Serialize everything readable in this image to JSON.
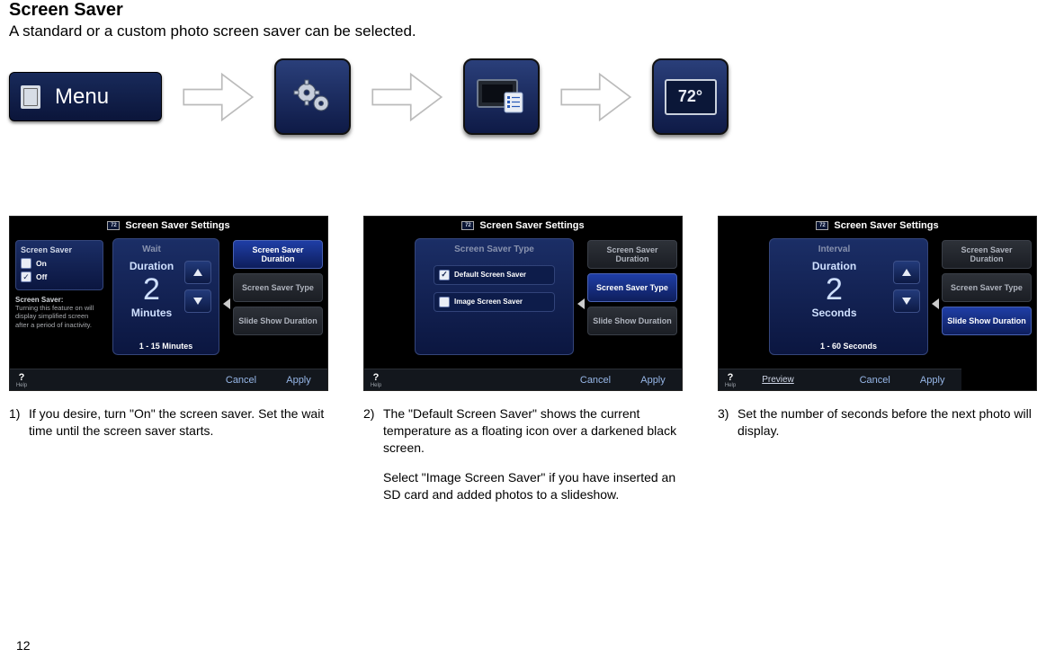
{
  "header": {
    "title": "Screen Saver",
    "subtitle": "A standard or a custom photo screen saver can be selected."
  },
  "nav": {
    "menu_label": "Menu",
    "temp_display": "72°"
  },
  "panel_labels": {
    "title": "Screen Saver Settings",
    "btn_duration": "Screen Saver Duration",
    "btn_type": "Screen Saver Type",
    "btn_slide": "Slide Show Duration",
    "help": "?",
    "help_sub": "Help",
    "cancel": "Cancel",
    "apply": "Apply",
    "preview": "Preview"
  },
  "panel1": {
    "box_title": "Screen Saver",
    "on": "On",
    "off": "Off",
    "hint_title": "Screen Saver:",
    "hint": "Turning this feature on will display simplified screen after a period of inactivity.",
    "wait_label": "Wait",
    "duration_label": "Duration",
    "value": "2",
    "unit": "Minutes",
    "range": "1 - 15 Minutes",
    "active": "duration"
  },
  "panel2": {
    "box_title": "Screen Saver Type",
    "opt_default": "Default Screen Saver",
    "opt_image": "Image Screen Saver",
    "active": "type"
  },
  "panel3": {
    "box_title": "Interval",
    "duration_label": "Duration",
    "value": "2",
    "unit": "Seconds",
    "range": "1 - 60 Seconds",
    "active": "slide"
  },
  "steps": {
    "s1_num": "1)",
    "s1": "If you desire, turn \"On\" the screen saver. Set the wait time until the screen saver starts.",
    "s2_num": "2)",
    "s2a": "The \"Default Screen Saver\" shows the current temperature as a floating icon over a darkened black screen.",
    "s2b": "Select \"Image Screen Saver\" if you have inserted an SD card and added photos to a slideshow.",
    "s3_num": "3)",
    "s3": "Set the number of seconds before the next photo will display."
  },
  "page_number": "12"
}
